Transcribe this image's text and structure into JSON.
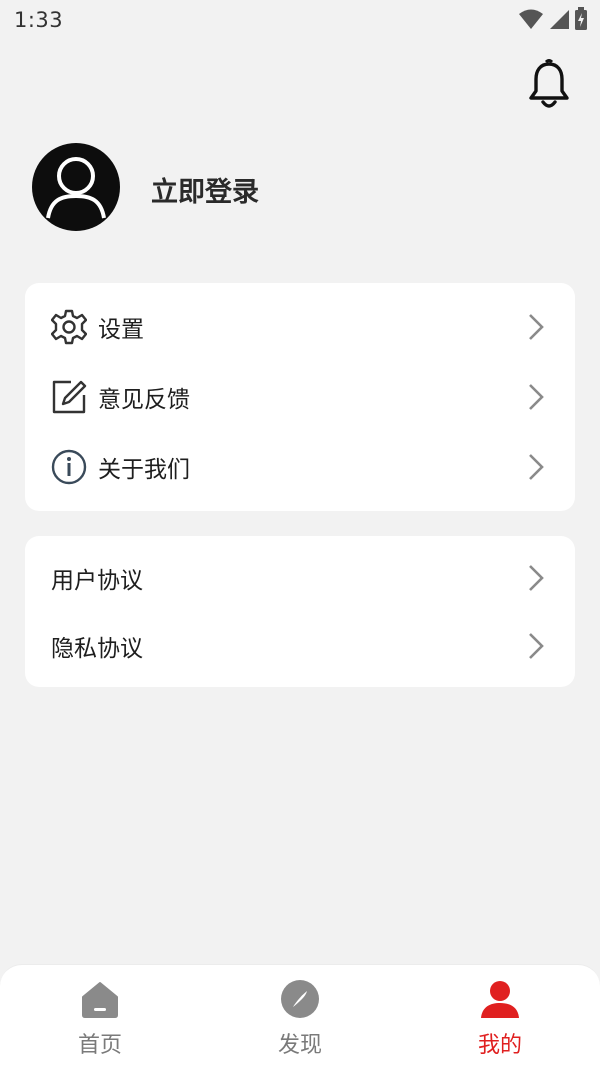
{
  "status_bar": {
    "time": "1:33"
  },
  "profile": {
    "login_label": "立即登录"
  },
  "menu_group_1": [
    {
      "label": "设置",
      "icon": "gear-icon"
    },
    {
      "label": "意见反馈",
      "icon": "edit-icon"
    },
    {
      "label": "关于我们",
      "icon": "info-icon"
    }
  ],
  "menu_group_2": [
    {
      "label": "用户协议"
    },
    {
      "label": "隐私协议"
    }
  ],
  "bottom_nav": [
    {
      "label": "首页",
      "icon": "home-icon",
      "active": false
    },
    {
      "label": "发现",
      "icon": "compass-icon",
      "active": false
    },
    {
      "label": "我的",
      "icon": "person-icon",
      "active": true
    }
  ],
  "colors": {
    "accent": "#e02020",
    "inactive": "#7a7a7a",
    "background": "#f2f2f2",
    "card": "#ffffff"
  }
}
